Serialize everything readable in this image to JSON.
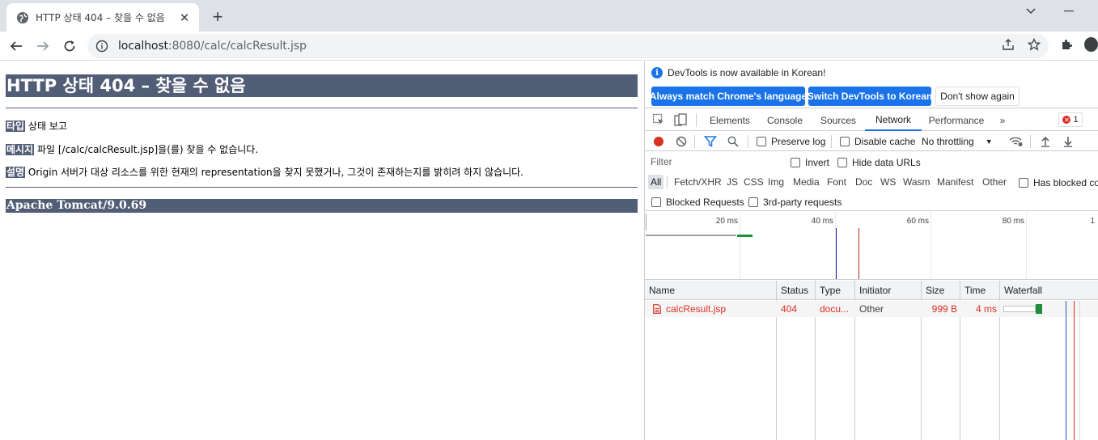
{
  "browser": {
    "tab_title": "HTTP 상태 404 – 찾을 수 없음",
    "url_host": "localhost",
    "url_rest": ":8080/calc/calcResult.jsp"
  },
  "page": {
    "heading": "HTTP 상태 404 – 찾을 수 없음",
    "type_label": "타입",
    "type_value": "상태 보고",
    "message_label": "메시지",
    "message_value": "파일 [/calc/calcResult.jsp]을(를) 찾을 수 없습니다.",
    "description_label": "설명",
    "description_value": "Origin 서버가 대상 리소스를 위한 현재의 representation을 찾지 못했거나, 그것이 존재하는지를 밝히려 하지 않습니다.",
    "footer": "Apache Tomcat/9.0.69"
  },
  "devtools": {
    "infobar": {
      "message": "DevTools is now available in Korean!",
      "btn_match": "Always match Chrome's language",
      "btn_switch": "Switch DevTools to Korean",
      "btn_dismiss": "Don't show again"
    },
    "tabs": [
      "Elements",
      "Console",
      "Sources",
      "Network",
      "Performance"
    ],
    "more_tabs": "»",
    "error_count": "1",
    "toolbar": {
      "preserve_log": "Preserve log",
      "disable_cache": "Disable cache",
      "throttling": "No throttling"
    },
    "filter": {
      "placeholder": "Filter",
      "invert": "Invert",
      "hide_data_urls": "Hide data URLs"
    },
    "type_filters": [
      "All",
      "Fetch/XHR",
      "JS",
      "CSS",
      "Img",
      "Media",
      "Font",
      "Doc",
      "WS",
      "Wasm",
      "Manifest",
      "Other"
    ],
    "has_blocked_cookies": "Has blocked co",
    "blocked_requests": "Blocked Requests",
    "third_party": "3rd-party requests",
    "timeline_ticks": [
      "20 ms",
      "40 ms",
      "60 ms",
      "80 ms",
      "1"
    ],
    "columns": [
      "Name",
      "Status",
      "Type",
      "Initiator",
      "Size",
      "Time",
      "Waterfall"
    ],
    "rows": [
      {
        "name": "calcResult.jsp",
        "status": "404",
        "type": "docu...",
        "initiator": "Other",
        "size": "999 B",
        "time": "4 ms"
      }
    ]
  },
  "colors": {
    "tomcat_header": "#525d76",
    "accent": "#1a73e8",
    "error": "#d93025"
  }
}
